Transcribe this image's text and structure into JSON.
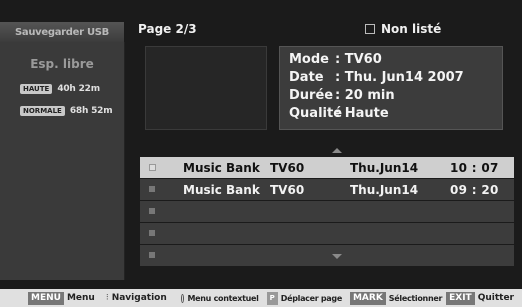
{
  "tab": {
    "label": "Sauvegarder USB"
  },
  "sidebar": {
    "title": "Esp. libre",
    "rows": [
      {
        "badge": "HAUTE",
        "time": "40h 22m"
      },
      {
        "badge": "NORMALE",
        "time": "68h 52m"
      }
    ]
  },
  "header": {
    "page": "Page 2/3",
    "filter": "Non listé"
  },
  "info": {
    "mode_label": "Mode",
    "mode_value": ": TV60",
    "date_label": "Date",
    "date_value": ": Thu. Jun14 2007",
    "duree_label": "Durée",
    "duree_value": ": 20 min",
    "qualite_label": "Qualité",
    "qualite_value": ": Haute"
  },
  "list": [
    {
      "title": "Music Bank",
      "channel": "TV60",
      "date": "Thu.Jun14",
      "time": "10 : 07",
      "selected": true
    },
    {
      "title": "Music Bank",
      "channel": "TV60",
      "date": "Thu.Jun14",
      "time": "09 : 20",
      "selected": false
    },
    {
      "title": "",
      "channel": "",
      "date": "",
      "time": "",
      "selected": false
    },
    {
      "title": "",
      "channel": "",
      "date": "",
      "time": "",
      "selected": false
    },
    {
      "title": "",
      "channel": "",
      "date": "",
      "time": "",
      "selected": false
    }
  ],
  "footer": {
    "menu_key": "MENU",
    "menu_label": "Menu",
    "nav_label": "Navigation",
    "context_label": "Menu contextuel",
    "move_key": "P",
    "move_label": "Déplacer page",
    "mark_key": "MARK",
    "mark_label": "Sélectionner",
    "exit_key": "EXIT",
    "exit_label": "Quitter"
  }
}
